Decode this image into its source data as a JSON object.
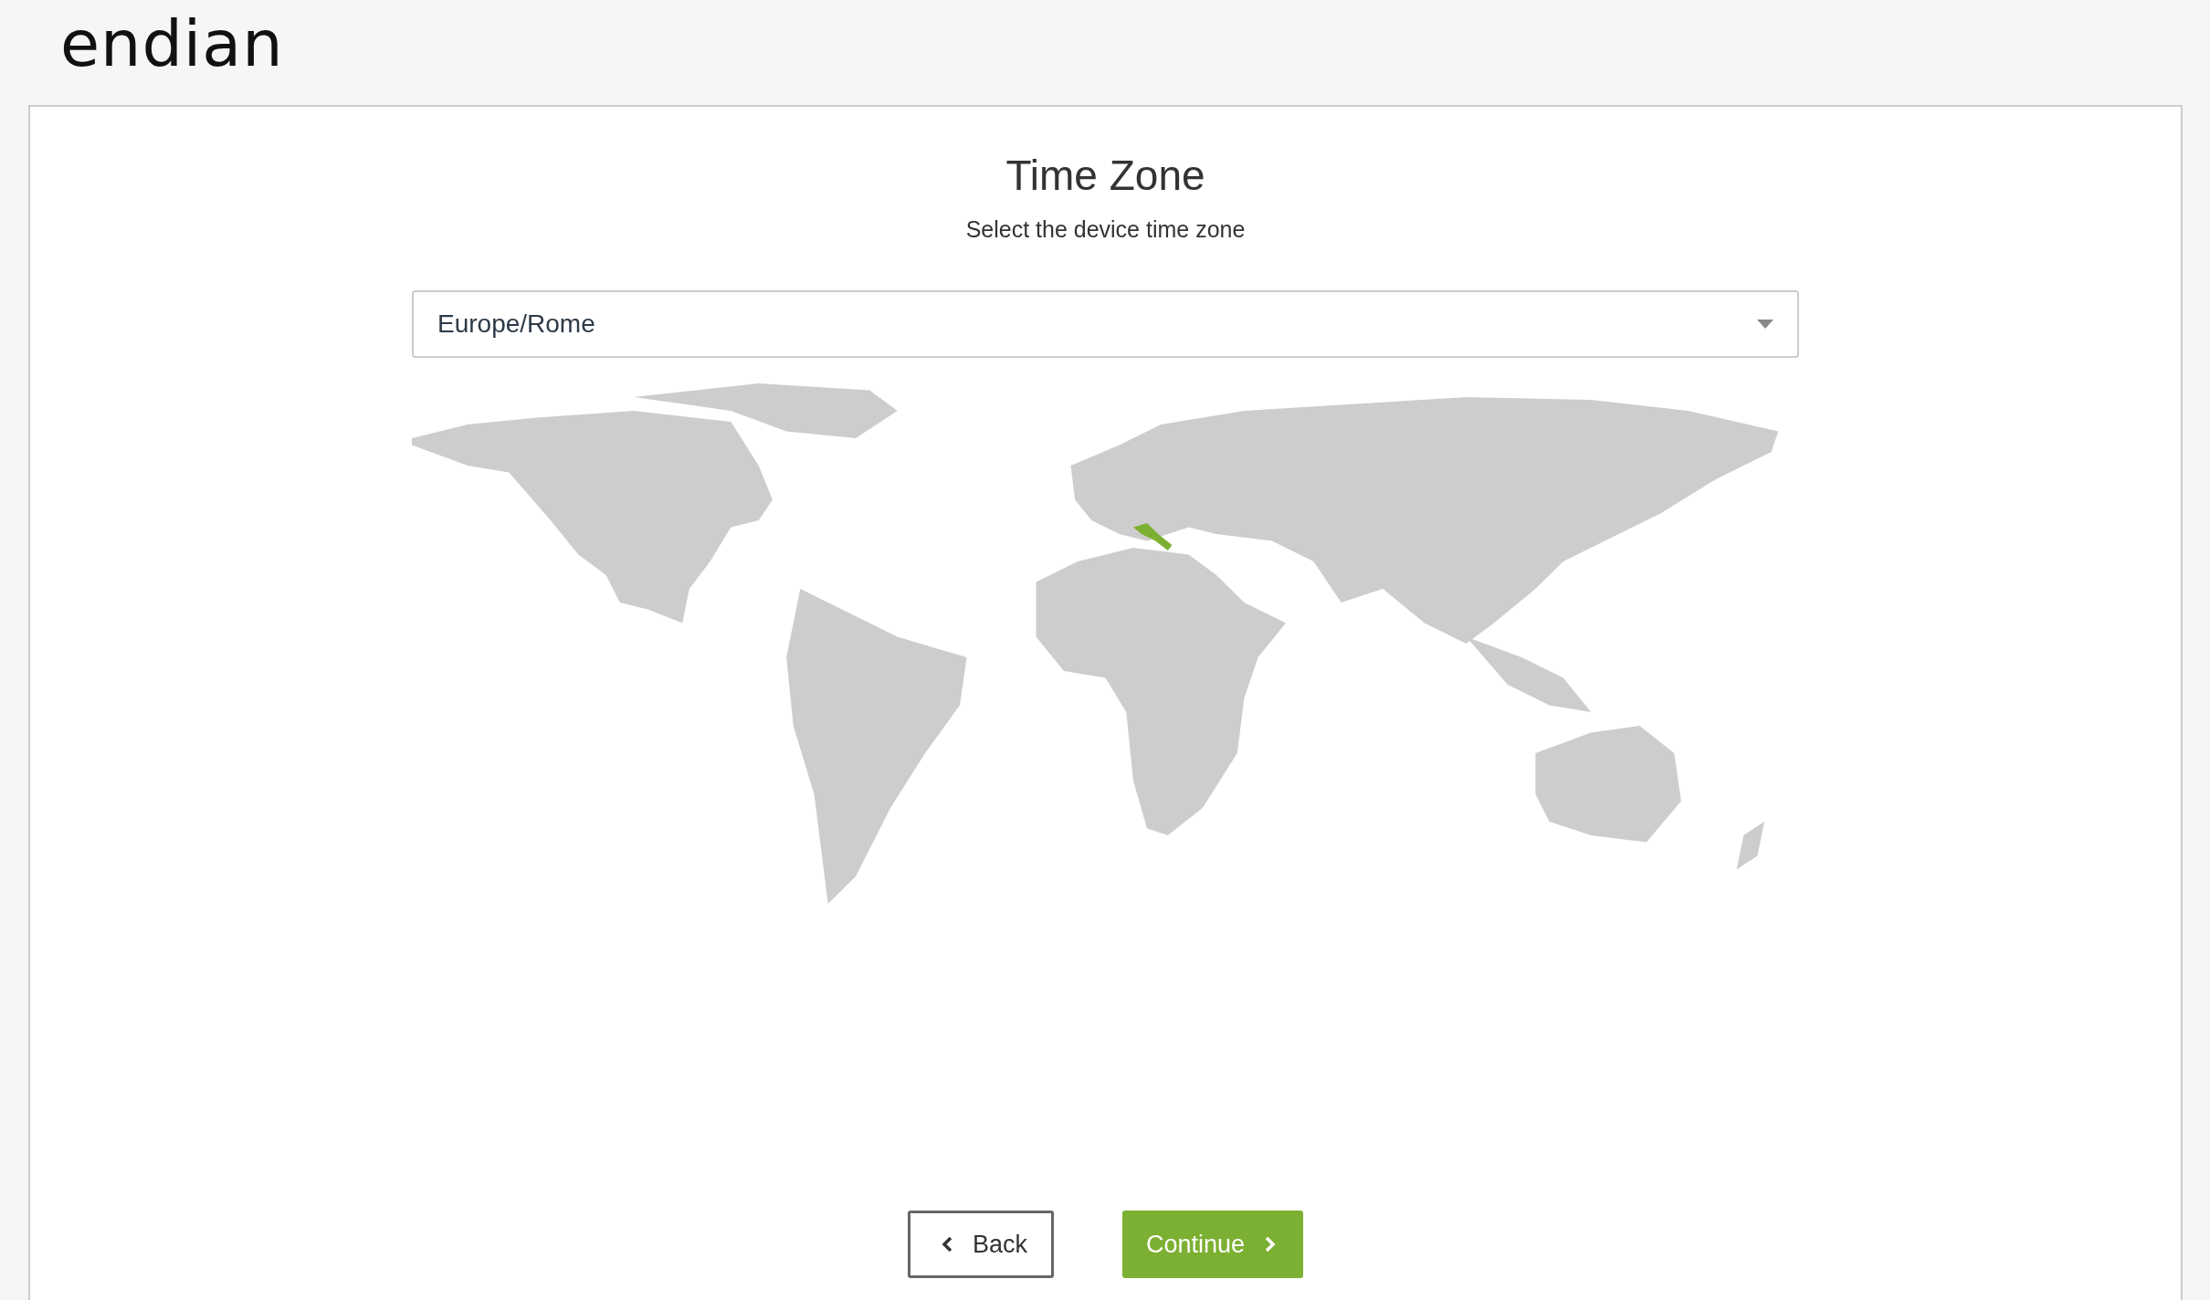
{
  "logo": "endian",
  "title": "Time Zone",
  "subtitle": "Select the device time zone",
  "timezone_select": {
    "value": "Europe/Rome"
  },
  "buttons": [
    {
      "kind": "back",
      "label": "Back"
    },
    {
      "kind": "continue",
      "label": "Continue"
    }
  ]
}
